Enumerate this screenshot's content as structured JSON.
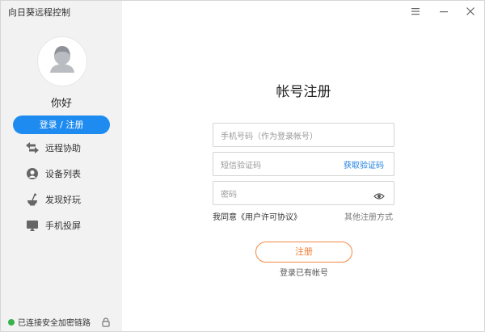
{
  "app": {
    "title": "向日葵远程控制"
  },
  "sidebar": {
    "username": "你好",
    "login_button": "登录 / 注册",
    "items": [
      {
        "label": "远程协助",
        "icon": "remote-assist-icon"
      },
      {
        "label": "设备列表",
        "icon": "device-list-icon"
      },
      {
        "label": "发现好玩",
        "icon": "discover-icon"
      },
      {
        "label": "手机投屏",
        "icon": "screen-cast-icon"
      }
    ],
    "status": "已连接安全加密链路"
  },
  "form": {
    "title": "帐号注册",
    "phone_placeholder": "手机号码（作为登录帐号）",
    "code_placeholder": "短信验证码",
    "get_code": "获取验证码",
    "password_placeholder": "密码",
    "agreement": "我同意《用户许可协议》",
    "other_methods": "其他注册方式",
    "register_button": "注册",
    "login_link": "登录已有帐号"
  },
  "colors": {
    "accent": "#1e8bf0",
    "register": "#f07a30",
    "status_ok": "#38b349",
    "sidebar_bg": "#f2f2f2"
  }
}
